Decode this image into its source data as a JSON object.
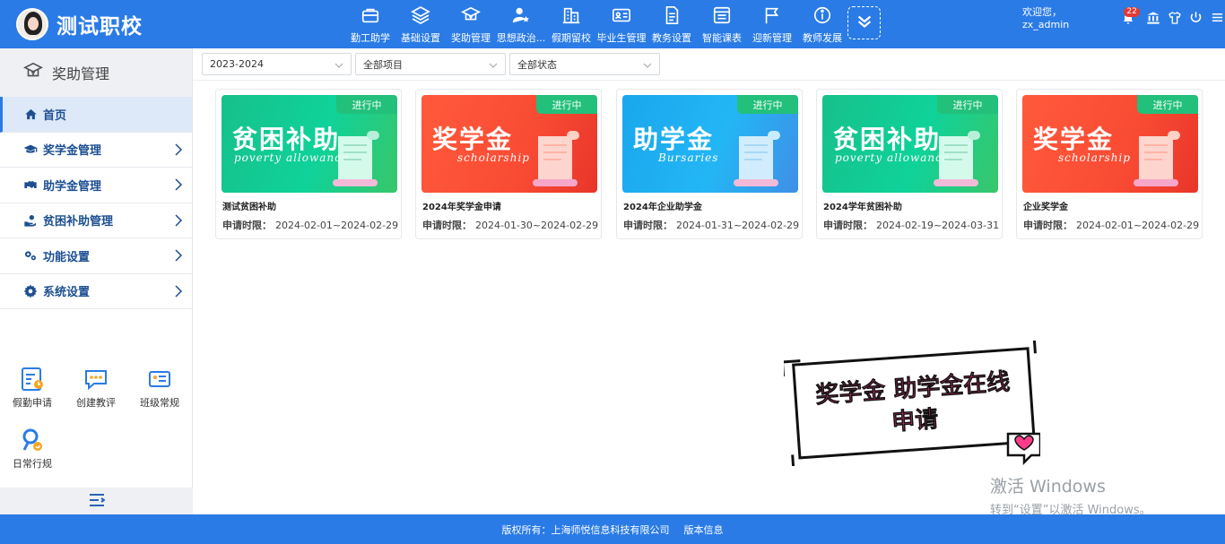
{
  "header": {
    "school_name": "测试职校",
    "nav": [
      {
        "label": "勤工助学",
        "icon": "briefcase-icon"
      },
      {
        "label": "基础设置",
        "icon": "layers-icon"
      },
      {
        "label": "奖助管理",
        "icon": "graduation-money-icon"
      },
      {
        "label": "思想政治...",
        "icon": "user-star-icon"
      },
      {
        "label": "假期留校",
        "icon": "building-icon"
      },
      {
        "label": "毕业生管理",
        "icon": "id-card-icon"
      },
      {
        "label": "教务设置",
        "icon": "document-icon"
      },
      {
        "label": "智能课表",
        "icon": "schedule-icon"
      },
      {
        "label": "迎新管理",
        "icon": "flag-icon"
      },
      {
        "label": "教师发展",
        "icon": "info-icon"
      }
    ],
    "welcome": "欢迎您，zx_admin",
    "notification_count": "22"
  },
  "sidebar": {
    "title": "奖助管理",
    "items": [
      {
        "label": "首页",
        "icon": "home-icon"
      },
      {
        "label": "奖学金管理",
        "icon": "graduation-cap-icon"
      },
      {
        "label": "助学金管理",
        "icon": "handshake-icon"
      },
      {
        "label": "贫困补助管理",
        "icon": "hand-money-icon"
      },
      {
        "label": "功能设置",
        "icon": "gears-icon"
      },
      {
        "label": "系统设置",
        "icon": "gear-icon"
      }
    ],
    "quick": [
      {
        "label": "假勤申请"
      },
      {
        "label": "创建教评"
      },
      {
        "label": "班级常规"
      },
      {
        "label": "日常行规"
      }
    ]
  },
  "filters": {
    "year": "2023-2024",
    "project": "全部项目",
    "status": "全部状态"
  },
  "cards": [
    {
      "banner_title": "贫困补助",
      "banner_sub": "poverty allowance",
      "status": "进行中",
      "title": "测试贫困补助",
      "date_label": "申请时限：",
      "date_range": "2024-02-01~2024-02-29",
      "theme": "green"
    },
    {
      "banner_title": "奖学金",
      "banner_sub": "scholarship",
      "status": "进行中",
      "title": "2024年奖学金申请",
      "date_label": "申请时限：",
      "date_range": "2024-01-30~2024-02-29",
      "theme": "red"
    },
    {
      "banner_title": "助学金",
      "banner_sub": "Bursaries",
      "status": "进行中",
      "title": "2024年企业助学金",
      "date_label": "申请时限：",
      "date_range": "2024-01-31~2024-02-29",
      "theme": "blue"
    },
    {
      "banner_title": "贫困补助",
      "banner_sub": "poverty allowance",
      "status": "进行中",
      "title": "2024学年贫困补助",
      "date_label": "申请时限：",
      "date_range": "2024-02-19~2024-03-31",
      "theme": "green"
    },
    {
      "banner_title": "奖学金",
      "banner_sub": "scholarship",
      "status": "进行中",
      "title": "企业奖学金",
      "date_label": "申请时限：",
      "date_range": "2024-02-01~2024-02-29",
      "theme": "red"
    }
  ],
  "promo": {
    "line1": "奖学金 助学金在线",
    "line2": "申请"
  },
  "watermark": {
    "line1": "激活 Windows",
    "line2": "转到“设置”以激活 Windows。"
  },
  "footer": {
    "copyright": "版权所有：上海师悦信息科技有限公司",
    "version": "版本信息"
  },
  "colors": {
    "primary": "#2a7be6",
    "status_green": "#22c07a",
    "promo_pink": "#ff3d8b"
  }
}
